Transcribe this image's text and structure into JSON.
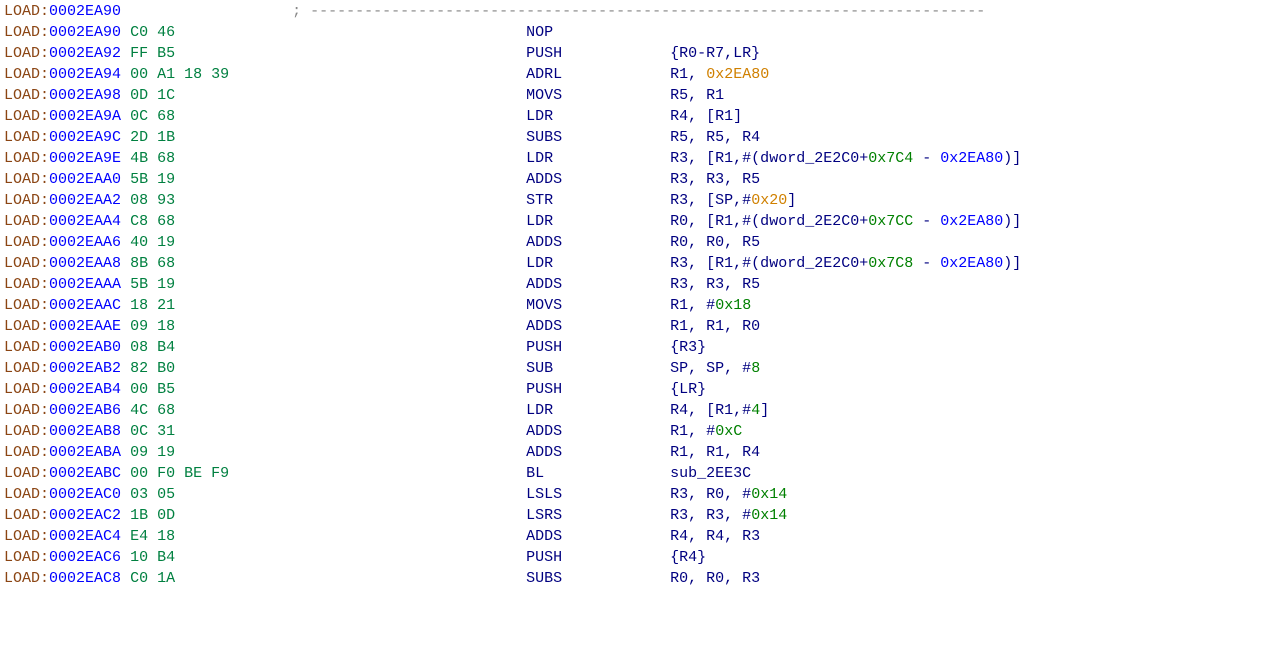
{
  "segment": "LOAD",
  "comment_dashes": "---------------------------------------------------------------------------",
  "lines": [
    {
      "addr": "0002EA90",
      "bytes": "",
      "mnemonic": "",
      "operand_spans": [],
      "comment": true
    },
    {
      "addr": "0002EA90",
      "bytes": "C0 46",
      "mnemonic": "NOP",
      "operand_spans": []
    },
    {
      "addr": "0002EA92",
      "bytes": "FF B5",
      "mnemonic": "PUSH",
      "operand_spans": [
        {
          "t": "{R0-R7,LR}",
          "c": "op"
        }
      ]
    },
    {
      "addr": "0002EA94",
      "bytes": "00 A1 18 39",
      "mnemonic": "ADRL",
      "operand_spans": [
        {
          "t": "R1, ",
          "c": "op"
        },
        {
          "t": "0x2EA80",
          "c": "ora"
        }
      ]
    },
    {
      "addr": "0002EA98",
      "bytes": "0D 1C",
      "mnemonic": "MOVS",
      "operand_spans": [
        {
          "t": "R5, R1",
          "c": "op"
        }
      ]
    },
    {
      "addr": "0002EA9A",
      "bytes": "0C 68",
      "mnemonic": "LDR",
      "operand_spans": [
        {
          "t": "R4, [R1]",
          "c": "op"
        }
      ]
    },
    {
      "addr": "0002EA9C",
      "bytes": "2D 1B",
      "mnemonic": "SUBS",
      "operand_spans": [
        {
          "t": "R5, R5, R4",
          "c": "op"
        }
      ]
    },
    {
      "addr": "0002EA9E",
      "bytes": "4B 68",
      "mnemonic": "LDR",
      "operand_spans": [
        {
          "t": "R3, [R1,#(dword_2E2C0+",
          "c": "op"
        },
        {
          "t": "0x7C4",
          "c": "num"
        },
        {
          "t": " - ",
          "c": "op"
        },
        {
          "t": "0x2EA80",
          "c": "addr"
        },
        {
          "t": ")]",
          "c": "op"
        }
      ]
    },
    {
      "addr": "0002EAA0",
      "bytes": "5B 19",
      "mnemonic": "ADDS",
      "operand_spans": [
        {
          "t": "R3, R3, R5",
          "c": "op"
        }
      ]
    },
    {
      "addr": "0002EAA2",
      "bytes": "08 93",
      "mnemonic": "STR",
      "operand_spans": [
        {
          "t": "R3, [SP,#",
          "c": "op"
        },
        {
          "t": "0x20",
          "c": "ora"
        },
        {
          "t": "]",
          "c": "op"
        }
      ]
    },
    {
      "addr": "0002EAA4",
      "bytes": "C8 68",
      "mnemonic": "LDR",
      "operand_spans": [
        {
          "t": "R0, [R1,#(dword_2E2C0+",
          "c": "op"
        },
        {
          "t": "0x7CC",
          "c": "num"
        },
        {
          "t": " - ",
          "c": "op"
        },
        {
          "t": "0x2EA80",
          "c": "addr"
        },
        {
          "t": ")]",
          "c": "op"
        }
      ]
    },
    {
      "addr": "0002EAA6",
      "bytes": "40 19",
      "mnemonic": "ADDS",
      "operand_spans": [
        {
          "t": "R0, R0, R5",
          "c": "op"
        }
      ]
    },
    {
      "addr": "0002EAA8",
      "bytes": "8B 68",
      "mnemonic": "LDR",
      "operand_spans": [
        {
          "t": "R3, [R1,#(dword_2E2C0+",
          "c": "op"
        },
        {
          "t": "0x7C8",
          "c": "num"
        },
        {
          "t": " - ",
          "c": "op"
        },
        {
          "t": "0x2EA80",
          "c": "addr"
        },
        {
          "t": ")]",
          "c": "op"
        }
      ]
    },
    {
      "addr": "0002EAAA",
      "bytes": "5B 19",
      "mnemonic": "ADDS",
      "operand_spans": [
        {
          "t": "R3, R3, R5",
          "c": "op"
        }
      ]
    },
    {
      "addr": "0002EAAC",
      "bytes": "18 21",
      "mnemonic": "MOVS",
      "operand_spans": [
        {
          "t": "R1, #",
          "c": "op"
        },
        {
          "t": "0x18",
          "c": "num"
        }
      ]
    },
    {
      "addr": "0002EAAE",
      "bytes": "09 18",
      "mnemonic": "ADDS",
      "operand_spans": [
        {
          "t": "R1, R1, R0",
          "c": "op"
        }
      ]
    },
    {
      "addr": "0002EAB0",
      "bytes": "08 B4",
      "mnemonic": "PUSH",
      "operand_spans": [
        {
          "t": "{R3}",
          "c": "op"
        }
      ]
    },
    {
      "addr": "0002EAB2",
      "bytes": "82 B0",
      "mnemonic": "SUB",
      "operand_spans": [
        {
          "t": "SP, SP, #",
          "c": "op"
        },
        {
          "t": "8",
          "c": "num"
        }
      ]
    },
    {
      "addr": "0002EAB4",
      "bytes": "00 B5",
      "mnemonic": "PUSH",
      "operand_spans": [
        {
          "t": "{LR}",
          "c": "op"
        }
      ]
    },
    {
      "addr": "0002EAB6",
      "bytes": "4C 68",
      "mnemonic": "LDR",
      "operand_spans": [
        {
          "t": "R4, [R1,#",
          "c": "op"
        },
        {
          "t": "4",
          "c": "num"
        },
        {
          "t": "]",
          "c": "op"
        }
      ]
    },
    {
      "addr": "0002EAB8",
      "bytes": "0C 31",
      "mnemonic": "ADDS",
      "operand_spans": [
        {
          "t": "R1, #",
          "c": "op"
        },
        {
          "t": "0xC",
          "c": "num"
        }
      ]
    },
    {
      "addr": "0002EABA",
      "bytes": "09 19",
      "mnemonic": "ADDS",
      "operand_spans": [
        {
          "t": "R1, R1, R4",
          "c": "op"
        }
      ]
    },
    {
      "addr": "0002EABC",
      "bytes": "00 F0 BE F9",
      "mnemonic": "BL",
      "operand_spans": [
        {
          "t": "sub_2EE3C",
          "c": "op"
        }
      ]
    },
    {
      "addr": "0002EAC0",
      "bytes": "03 05",
      "mnemonic": "LSLS",
      "operand_spans": [
        {
          "t": "R3, R0, #",
          "c": "op"
        },
        {
          "t": "0x14",
          "c": "num"
        }
      ]
    },
    {
      "addr": "0002EAC2",
      "bytes": "1B 0D",
      "mnemonic": "LSRS",
      "operand_spans": [
        {
          "t": "R3, R3, #",
          "c": "op"
        },
        {
          "t": "0x14",
          "c": "num"
        }
      ]
    },
    {
      "addr": "0002EAC4",
      "bytes": "E4 18",
      "mnemonic": "ADDS",
      "operand_spans": [
        {
          "t": "R4, R4, R3",
          "c": "op"
        }
      ]
    },
    {
      "addr": "0002EAC6",
      "bytes": "10 B4",
      "mnemonic": "PUSH",
      "operand_spans": [
        {
          "t": "{R4}",
          "c": "op"
        }
      ]
    },
    {
      "addr": "0002EAC8",
      "bytes": "C0 1A",
      "mnemonic": "SUBS",
      "operand_spans": [
        {
          "t": "R0, R0, R3",
          "c": "op"
        }
      ]
    }
  ]
}
